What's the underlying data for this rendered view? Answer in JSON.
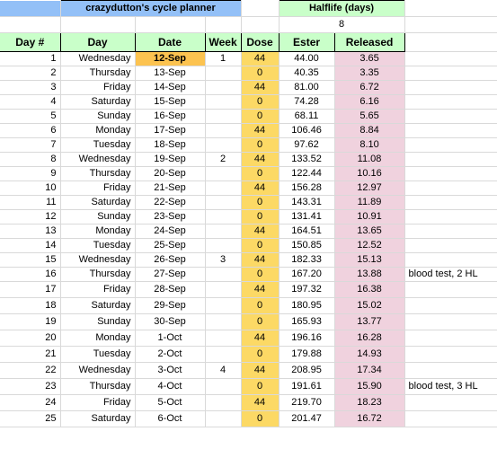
{
  "banner": {
    "title": "crazydutton's cycle planner",
    "halflife_label": "Halflife (days)",
    "halflife_value": "8"
  },
  "colors": {
    "banner_blue": "#93c0f7",
    "header_green": "#c9ffc9",
    "dose_amber": "#fcd965",
    "date_first_amber": "#fcc350",
    "released_pink": "#f0d2de",
    "grid_line": "#d9d9d9",
    "cell_border": "#000000"
  },
  "columns": {
    "daynum": "Day #",
    "day": "Day",
    "date": "Date",
    "week": "Week",
    "dose": "Dose",
    "ester": "Ester",
    "released": "Released"
  },
  "rows": [
    {
      "daynum": "1",
      "day": "Wednesday",
      "date": "12-Sep",
      "week": "1",
      "dose": "44",
      "ester": "44.00",
      "released": "3.65",
      "note": ""
    },
    {
      "daynum": "2",
      "day": "Thursday",
      "date": "13-Sep",
      "week": "",
      "dose": "0",
      "ester": "40.35",
      "released": "3.35",
      "note": ""
    },
    {
      "daynum": "3",
      "day": "Friday",
      "date": "14-Sep",
      "week": "",
      "dose": "44",
      "ester": "81.00",
      "released": "6.72",
      "note": ""
    },
    {
      "daynum": "4",
      "day": "Saturday",
      "date": "15-Sep",
      "week": "",
      "dose": "0",
      "ester": "74.28",
      "released": "6.16",
      "note": ""
    },
    {
      "daynum": "5",
      "day": "Sunday",
      "date": "16-Sep",
      "week": "",
      "dose": "0",
      "ester": "68.11",
      "released": "5.65",
      "note": ""
    },
    {
      "daynum": "6",
      "day": "Monday",
      "date": "17-Sep",
      "week": "",
      "dose": "44",
      "ester": "106.46",
      "released": "8.84",
      "note": ""
    },
    {
      "daynum": "7",
      "day": "Tuesday",
      "date": "18-Sep",
      "week": "",
      "dose": "0",
      "ester": "97.62",
      "released": "8.10",
      "note": ""
    },
    {
      "daynum": "8",
      "day": "Wednesday",
      "date": "19-Sep",
      "week": "2",
      "dose": "44",
      "ester": "133.52",
      "released": "11.08",
      "note": ""
    },
    {
      "daynum": "9",
      "day": "Thursday",
      "date": "20-Sep",
      "week": "",
      "dose": "0",
      "ester": "122.44",
      "released": "10.16",
      "note": ""
    },
    {
      "daynum": "10",
      "day": "Friday",
      "date": "21-Sep",
      "week": "",
      "dose": "44",
      "ester": "156.28",
      "released": "12.97",
      "note": ""
    },
    {
      "daynum": "11",
      "day": "Saturday",
      "date": "22-Sep",
      "week": "",
      "dose": "0",
      "ester": "143.31",
      "released": "11.89",
      "note": ""
    },
    {
      "daynum": "12",
      "day": "Sunday",
      "date": "23-Sep",
      "week": "",
      "dose": "0",
      "ester": "131.41",
      "released": "10.91",
      "note": ""
    },
    {
      "daynum": "13",
      "day": "Monday",
      "date": "24-Sep",
      "week": "",
      "dose": "44",
      "ester": "164.51",
      "released": "13.65",
      "note": ""
    },
    {
      "daynum": "14",
      "day": "Tuesday",
      "date": "25-Sep",
      "week": "",
      "dose": "0",
      "ester": "150.85",
      "released": "12.52",
      "note": ""
    },
    {
      "daynum": "15",
      "day": "Wednesday",
      "date": "26-Sep",
      "week": "3",
      "dose": "44",
      "ester": "182.33",
      "released": "15.13",
      "note": ""
    },
    {
      "daynum": "16",
      "day": "Thursday",
      "date": "27-Sep",
      "week": "",
      "dose": "0",
      "ester": "167.20",
      "released": "13.88",
      "note": "blood test, 2 HL"
    },
    {
      "daynum": "17",
      "day": "Friday",
      "date": "28-Sep",
      "week": "",
      "dose": "44",
      "ester": "197.32",
      "released": "16.38",
      "note": ""
    },
    {
      "daynum": "18",
      "day": "Saturday",
      "date": "29-Sep",
      "week": "",
      "dose": "0",
      "ester": "180.95",
      "released": "15.02",
      "note": ""
    },
    {
      "daynum": "19",
      "day": "Sunday",
      "date": "30-Sep",
      "week": "",
      "dose": "0",
      "ester": "165.93",
      "released": "13.77",
      "note": ""
    },
    {
      "daynum": "20",
      "day": "Monday",
      "date": "1-Oct",
      "week": "",
      "dose": "44",
      "ester": "196.16",
      "released": "16.28",
      "note": ""
    },
    {
      "daynum": "21",
      "day": "Tuesday",
      "date": "2-Oct",
      "week": "",
      "dose": "0",
      "ester": "179.88",
      "released": "14.93",
      "note": ""
    },
    {
      "daynum": "22",
      "day": "Wednesday",
      "date": "3-Oct",
      "week": "4",
      "dose": "44",
      "ester": "208.95",
      "released": "17.34",
      "note": ""
    },
    {
      "daynum": "23",
      "day": "Thursday",
      "date": "4-Oct",
      "week": "",
      "dose": "0",
      "ester": "191.61",
      "released": "15.90",
      "note": "blood test, 3 HL"
    },
    {
      "daynum": "24",
      "day": "Friday",
      "date": "5-Oct",
      "week": "",
      "dose": "44",
      "ester": "219.70",
      "released": "18.23",
      "note": ""
    },
    {
      "daynum": "25",
      "day": "Saturday",
      "date": "6-Oct",
      "week": "",
      "dose": "0",
      "ester": "201.47",
      "released": "16.72",
      "note": ""
    }
  ]
}
